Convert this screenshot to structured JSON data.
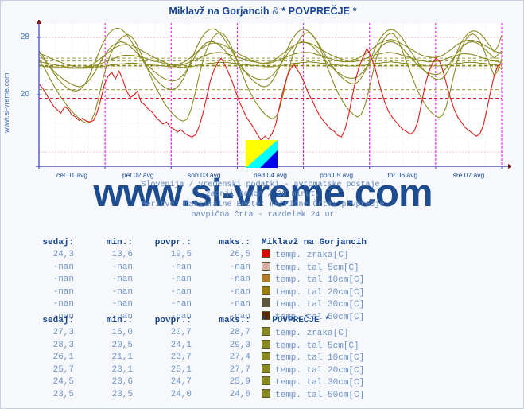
{
  "header": {
    "title_station": "Miklavž na Gorjancih",
    "title_amp": " & ",
    "title_average": "* POVPREČJE *"
  },
  "side_text": "www.si-vreme.com",
  "watermark": "www.si-vreme.com",
  "caption": {
    "line1": "Slovenija / vremenski podatki - avtomatske postaje:",
    "line2": "zadnji teden / 30 minut.",
    "line3": "Meritve: maksimalne  Enote: metrične  Črta: povprecje",
    "line4": "navpična črta - razdelek 24 ur"
  },
  "chart_data": {
    "type": "line",
    "title": "Miklavž na Gorjancih & * POVPREČJE *",
    "xlabel": "",
    "ylabel": "",
    "ylim": [
      10,
      30
    ],
    "yticks": [
      20,
      28
    ],
    "ytick_labels": [
      "20",
      "28"
    ],
    "xtick_labels": [
      "čet 01 avg",
      "pet 02 avg",
      "sob 03 avg",
      "ned 04 avg",
      "pon 05 avg",
      "tor 06 avg",
      "sre 07 avg"
    ],
    "grid": true,
    "legend_position": "below-table",
    "day_divider_color": "#ff00ff",
    "series": [
      {
        "name": "Miklavž na Gorjancih temp. zraka[C]",
        "color": "#e01b1b",
        "values": [
          21.5,
          20.9,
          20.1,
          19.2,
          18.4,
          17.9,
          17.4,
          18.3,
          18.0,
          17.2,
          16.9,
          16.4,
          16.7,
          16.3,
          16.2,
          16.4,
          17.6,
          19.4,
          21.5,
          22.6,
          23.1,
          22.2,
          23.3,
          22.1,
          20.6,
          19.6,
          19.9,
          20.5,
          19.0,
          18.6,
          18.0,
          17.6,
          16.9,
          16.4,
          15.9,
          16.2,
          15.5,
          15.2,
          14.8,
          15.1,
          14.6,
          14.3,
          14.1,
          14.4,
          15.6,
          17.4,
          19.6,
          21.9,
          23.4,
          24.4,
          25.1,
          24.2,
          23.1,
          21.9,
          20.4,
          19.0,
          17.9,
          16.8,
          16.1,
          15.3,
          14.4,
          13.6,
          14.2,
          13.8,
          14.6,
          15.9,
          18.3,
          20.6,
          22.4,
          23.6,
          24.2,
          23.4,
          22.6,
          21.4,
          20.1,
          19.2,
          18.1,
          17.1,
          16.4,
          15.8,
          15.2,
          14.9,
          14.3,
          14.1,
          15.2,
          17.2,
          19.8,
          22.3,
          24.1,
          25.3,
          26.5,
          25.4,
          24.1,
          22.3,
          20.4,
          18.8,
          17.6,
          16.8,
          16.2,
          15.6,
          15.1,
          14.8,
          14.5,
          14.9,
          16.3,
          18.8,
          21.4,
          23.2,
          24.4,
          25.1,
          24.6,
          23.1,
          21.2,
          19.4,
          17.9,
          16.8,
          16.1,
          15.4,
          15.0,
          14.6,
          14.2,
          14.5,
          15.8,
          18.1,
          20.6,
          22.8,
          24.1,
          24.3
        ]
      },
      {
        "name": "* POVPREČJE * temp. zraka[C]",
        "color": "#8a8a22",
        "values": [
          24.8,
          24.1,
          23.2,
          22.2,
          21.3,
          20.4,
          19.6,
          18.9,
          18.2,
          17.6,
          17.1,
          16.6,
          16.2,
          16.0,
          16.3,
          17.4,
          19.3,
          21.6,
          23.6,
          25.2,
          26.4,
          27.2,
          27.8,
          28.2,
          28.4,
          28.1,
          27.4,
          26.4,
          25.2,
          24.0,
          22.8,
          21.6,
          20.6,
          19.6,
          18.7,
          18.0,
          17.4,
          16.9,
          16.5,
          16.3,
          16.6,
          17.8,
          19.8,
          22.1,
          24.2,
          25.9,
          27.1,
          28.0,
          28.5,
          28.7,
          28.4,
          27.7,
          26.7,
          25.4,
          24.1,
          22.8,
          21.5,
          20.4,
          19.4,
          18.6,
          17.9,
          17.3,
          16.9,
          16.6,
          16.9,
          18.1,
          20.1,
          22.4,
          24.5,
          26.2,
          27.4,
          28.2,
          28.6,
          28.7,
          28.3,
          27.5,
          26.4,
          25.1,
          23.7,
          22.4,
          21.1,
          20.0,
          19.1,
          18.3,
          17.7,
          17.2,
          16.9,
          17.2,
          18.4,
          20.4,
          22.7,
          24.8,
          26.4,
          27.6,
          28.3,
          28.6,
          28.4,
          27.6,
          26.4,
          25.0,
          23.6,
          22.2,
          20.9,
          19.8,
          18.9,
          18.1,
          17.5,
          17.1,
          16.8,
          17.1,
          18.3,
          20.3,
          22.6,
          24.7,
          26.3,
          27.5,
          28.2,
          28.5,
          28.3,
          27.6,
          26.5,
          25.2,
          23.9,
          22.6,
          23.4,
          25.0
        ]
      },
      {
        "name": "* POVPREČJE * temp. tal 5cm[C]",
        "color": "#8a8a22",
        "values": [
          26.1,
          25.4,
          24.6,
          23.8,
          23.0,
          22.3,
          21.7,
          21.2,
          20.8,
          20.6,
          20.5,
          20.7,
          21.2,
          22.0,
          23.1,
          24.4,
          25.7,
          26.9,
          27.9,
          28.6,
          29.1,
          29.3,
          29.2,
          28.8,
          28.2,
          27.4,
          26.6,
          25.7,
          24.8,
          24.0,
          23.2,
          22.5,
          21.9,
          21.4,
          21.0,
          20.8,
          20.7,
          20.9,
          21.4,
          22.2,
          23.3,
          24.6,
          25.9,
          27.1,
          28.0,
          28.7,
          29.1,
          29.2,
          29.0,
          28.5,
          27.8,
          27.0,
          26.2,
          25.3,
          24.5,
          23.7,
          23.0,
          22.4,
          21.9,
          21.5,
          21.2,
          21.1,
          21.3,
          21.9,
          22.8,
          23.9,
          25.1,
          26.3,
          27.4,
          28.2,
          28.8,
          29.1,
          29.1,
          28.8,
          28.2,
          27.5,
          26.7,
          25.8,
          25.0,
          24.2,
          23.5,
          22.8,
          22.3,
          21.9,
          21.6,
          21.5,
          21.7,
          22.3,
          23.2,
          24.3,
          25.5,
          26.7,
          27.7,
          28.4,
          28.9,
          29.1,
          29.0,
          28.6,
          28.0,
          27.2,
          26.4,
          25.6,
          24.8,
          24.1,
          23.4,
          22.9,
          22.5,
          22.2,
          22.1,
          22.3,
          22.9,
          23.8,
          24.9,
          26.1,
          27.2,
          28.0,
          28.6,
          28.9,
          28.9,
          28.6,
          28.1,
          27.4,
          26.7,
          26.0,
          26.8,
          28.3
        ]
      },
      {
        "name": "* POVPREČJE * temp. tal 10cm[C]",
        "color": "#8a8a22",
        "values": [
          25.6,
          25.1,
          24.5,
          23.9,
          23.3,
          22.8,
          22.4,
          22.0,
          21.7,
          21.4,
          21.2,
          21.1,
          21.3,
          21.7,
          22.3,
          23.1,
          24.0,
          24.9,
          25.7,
          26.4,
          26.9,
          27.2,
          27.4,
          27.3,
          27.0,
          26.6,
          26.1,
          25.5,
          24.9,
          24.3,
          23.8,
          23.3,
          22.9,
          22.5,
          22.2,
          22.0,
          21.9,
          22.0,
          22.3,
          22.8,
          23.5,
          24.3,
          25.2,
          26.0,
          26.7,
          27.2,
          27.4,
          27.4,
          27.2,
          26.8,
          26.3,
          25.7,
          25.1,
          24.5,
          24.0,
          23.5,
          23.1,
          22.7,
          22.4,
          22.2,
          22.1,
          22.1,
          22.3,
          22.7,
          23.3,
          24.0,
          24.8,
          25.6,
          26.3,
          26.9,
          27.2,
          27.4,
          27.3,
          27.1,
          26.7,
          26.2,
          25.6,
          25.0,
          24.4,
          23.9,
          23.4,
          23.0,
          22.7,
          22.4,
          22.3,
          22.3,
          22.5,
          22.9,
          23.5,
          24.2,
          25.0,
          25.8,
          26.5,
          27.0,
          27.3,
          27.4,
          27.3,
          27.0,
          26.6,
          26.0,
          25.4,
          24.9,
          24.3,
          23.8,
          23.4,
          23.1,
          22.9,
          22.8,
          22.9,
          23.2,
          23.7,
          24.4,
          25.1,
          25.9,
          26.5,
          27.0,
          27.3,
          27.4,
          27.3,
          27.0,
          26.6,
          26.1,
          25.6,
          25.1,
          25.6,
          26.1
        ]
      },
      {
        "name": "* POVPREČJE * temp. tal 20cm[C]",
        "color": "#8a8a22",
        "values": [
          25.8,
          25.6,
          25.4,
          25.1,
          24.9,
          24.7,
          24.5,
          24.3,
          24.2,
          24.0,
          23.9,
          23.8,
          23.8,
          23.9,
          24.1,
          24.4,
          24.8,
          25.2,
          25.6,
          26.0,
          26.4,
          26.7,
          26.9,
          27.0,
          27.0,
          26.9,
          26.7,
          26.4,
          26.1,
          25.8,
          25.5,
          25.2,
          25.0,
          24.7,
          24.5,
          24.3,
          24.2,
          24.2,
          24.3,
          24.5,
          24.8,
          25.2,
          25.6,
          26.1,
          26.5,
          26.8,
          27.1,
          27.2,
          27.2,
          27.1,
          26.9,
          26.6,
          26.3,
          26.0,
          25.7,
          25.4,
          25.2,
          24.9,
          24.7,
          24.5,
          24.4,
          24.4,
          24.5,
          24.7,
          25.0,
          25.4,
          25.8,
          26.2,
          26.6,
          26.9,
          27.2,
          27.3,
          27.3,
          27.2,
          27.0,
          26.7,
          26.4,
          26.1,
          25.8,
          25.5,
          25.3,
          25.1,
          24.9,
          24.8,
          24.8,
          24.9,
          25.0,
          25.3,
          25.6,
          26.0,
          26.4,
          26.8,
          27.2,
          27.4,
          27.6,
          27.7,
          27.6,
          27.4,
          27.1,
          26.8,
          26.5,
          26.2,
          25.9,
          25.6,
          25.4,
          25.3,
          25.2,
          25.2,
          25.3,
          25.5,
          25.8,
          26.2,
          26.6,
          27.0,
          27.3,
          27.5,
          27.6,
          27.6,
          27.5,
          27.3,
          27.0,
          26.7,
          26.4,
          26.1,
          25.9,
          25.7
        ]
      },
      {
        "name": "* POVPREČJE * temp. tal 30cm[C]",
        "color": "#8a8a22",
        "values": [
          24.6,
          24.5,
          24.4,
          24.3,
          24.2,
          24.1,
          24.0,
          23.9,
          23.8,
          23.8,
          23.7,
          23.7,
          23.7,
          23.8,
          23.9,
          24.0,
          24.2,
          24.4,
          24.6,
          24.8,
          25.0,
          25.2,
          25.4,
          25.5,
          25.5,
          25.5,
          25.4,
          25.3,
          25.2,
          25.0,
          24.9,
          24.7,
          24.6,
          24.5,
          24.3,
          24.2,
          24.1,
          24.1,
          24.1,
          24.2,
          24.4,
          24.6,
          24.8,
          25.0,
          25.3,
          25.5,
          25.7,
          25.8,
          25.9,
          25.9,
          25.8,
          25.7,
          25.5,
          25.3,
          25.2,
          25.0,
          24.9,
          24.7,
          24.6,
          24.5,
          24.4,
          24.4,
          24.4,
          24.5,
          24.7,
          24.9,
          25.1,
          25.3,
          25.5,
          25.7,
          25.8,
          25.9,
          25.9,
          25.9,
          25.8,
          25.6,
          25.5,
          25.3,
          25.1,
          25.0,
          24.8,
          24.7,
          24.6,
          24.6,
          24.6,
          24.6,
          24.7,
          24.8,
          25.0,
          25.2,
          25.4,
          25.6,
          25.7,
          25.8,
          25.9,
          25.9,
          25.8,
          25.7,
          25.5,
          25.4,
          25.2,
          25.0,
          24.9,
          24.8,
          24.7,
          24.6,
          24.6,
          24.6,
          24.7,
          24.8,
          25.0,
          25.2,
          25.4,
          25.5,
          25.7,
          25.7,
          25.7,
          25.6,
          25.5,
          25.3,
          25.1,
          25.0,
          24.8,
          24.7,
          24.6,
          24.5
        ]
      },
      {
        "name": "* POVPREČJE * temp. tal 50cm[C]",
        "color": "#8a8a22",
        "values": [
          24.0,
          24.0,
          23.9,
          23.9,
          23.9,
          23.8,
          23.8,
          23.8,
          23.7,
          23.7,
          23.7,
          23.7,
          23.7,
          23.7,
          23.8,
          23.8,
          23.9,
          23.9,
          24.0,
          24.1,
          24.2,
          24.2,
          24.3,
          24.3,
          24.4,
          24.4,
          24.4,
          24.3,
          24.3,
          24.2,
          24.2,
          24.1,
          24.1,
          24.0,
          24.0,
          23.9,
          23.9,
          23.9,
          23.8,
          23.8,
          23.9,
          23.9,
          24.0,
          24.1,
          24.2,
          24.3,
          24.4,
          24.4,
          24.5,
          24.5,
          24.5,
          24.5,
          24.4,
          24.4,
          24.3,
          24.2,
          24.2,
          24.1,
          24.1,
          24.0,
          24.0,
          23.9,
          23.9,
          23.9,
          24.0,
          24.0,
          24.1,
          24.2,
          24.3,
          24.4,
          24.4,
          24.5,
          24.5,
          24.6,
          24.5,
          24.5,
          24.4,
          24.4,
          24.3,
          24.2,
          24.2,
          24.1,
          24.1,
          24.0,
          24.0,
          24.0,
          24.0,
          24.1,
          24.1,
          24.2,
          24.3,
          24.4,
          24.4,
          24.5,
          24.5,
          24.6,
          24.5,
          24.5,
          24.4,
          24.4,
          24.3,
          24.2,
          24.2,
          24.1,
          24.1,
          24.0,
          24.0,
          24.0,
          24.0,
          24.1,
          24.1,
          24.2,
          24.3,
          24.4,
          24.4,
          24.5,
          24.5,
          24.5,
          24.5,
          24.4,
          24.4,
          24.3,
          24.2,
          24.2,
          24.1,
          23.5
        ]
      }
    ],
    "average_lines": [
      {
        "name": "Miklavž na Gorjancih temp. zraka avg",
        "value": 19.5,
        "color": "#e01b1b"
      },
      {
        "name": "* POVPREČJE * temp. zraka avg",
        "value": 20.7,
        "color": "#8a8a22"
      },
      {
        "name": "* POVPREČJE * temp. tal 5cm avg",
        "value": 24.1,
        "color": "#8a8a22"
      },
      {
        "name": "* POVPREČJE * temp. tal 10cm avg",
        "value": 23.7,
        "color": "#8a8a22"
      },
      {
        "name": "* POVPREČJE * temp. tal 20cm avg",
        "value": 25.1,
        "color": "#8a8a22"
      },
      {
        "name": "* POVPREČJE * temp. tal 30cm avg",
        "value": 24.7,
        "color": "#8a8a22"
      },
      {
        "name": "* POVPREČJE * temp. tal 50cm avg",
        "value": 24.0,
        "color": "#8a8a22"
      }
    ]
  },
  "tables": [
    {
      "group": "Miklavž na Gorjancih",
      "headers": [
        "sedaj:",
        "min.:",
        "povpr.:",
        "maks.:"
      ],
      "rows": [
        {
          "sedaj": "24,3",
          "min": "13,6",
          "povpr": "19,5",
          "maks": "26,5",
          "color": "#e00000",
          "label": "temp. zraka[C]"
        },
        {
          "sedaj": "-nan",
          "min": "-nan",
          "povpr": "-nan",
          "maks": "-nan",
          "color": "#d9b0b0",
          "label": "temp. tal  5cm[C]"
        },
        {
          "sedaj": "-nan",
          "min": "-nan",
          "povpr": "-nan",
          "maks": "-nan",
          "color": "#b07a28",
          "label": "temp. tal 10cm[C]"
        },
        {
          "sedaj": "-nan",
          "min": "-nan",
          "povpr": "-nan",
          "maks": "-nan",
          "color": "#9a7a08",
          "label": "temp. tal 20cm[C]"
        },
        {
          "sedaj": "-nan",
          "min": "-nan",
          "povpr": "-nan",
          "maks": "-nan",
          "color": "#5c5440",
          "label": "temp. tal 30cm[C]"
        },
        {
          "sedaj": "-nan",
          "min": "-nan",
          "povpr": "-nan",
          "maks": "-nan",
          "color": "#5e2b08",
          "label": "temp. tal 50cm[C]"
        }
      ]
    },
    {
      "group": "* POVPREČJE *",
      "headers": [
        "sedaj:",
        "min.:",
        "povpr.:",
        "maks.:"
      ],
      "rows": [
        {
          "sedaj": "27,3",
          "min": "15,0",
          "povpr": "20,7",
          "maks": "28,7",
          "color": "#8a8a22",
          "label": "temp. zraka[C]"
        },
        {
          "sedaj": "28,3",
          "min": "20,5",
          "povpr": "24,1",
          "maks": "29,3",
          "color": "#8a8a22",
          "label": "temp. tal  5cm[C]"
        },
        {
          "sedaj": "26,1",
          "min": "21,1",
          "povpr": "23,7",
          "maks": "27,4",
          "color": "#8a8a22",
          "label": "temp. tal 10cm[C]"
        },
        {
          "sedaj": "25,7",
          "min": "23,1",
          "povpr": "25,1",
          "maks": "27,7",
          "color": "#8a8a22",
          "label": "temp. tal 20cm[C]"
        },
        {
          "sedaj": "24,5",
          "min": "23,6",
          "povpr": "24,7",
          "maks": "25,9",
          "color": "#8a8a22",
          "label": "temp. tal 30cm[C]"
        },
        {
          "sedaj": "23,5",
          "min": "23,5",
          "povpr": "24,0",
          "maks": "24,6",
          "color": "#8a8a22",
          "label": "temp. tal 50cm[C]"
        }
      ]
    }
  ]
}
